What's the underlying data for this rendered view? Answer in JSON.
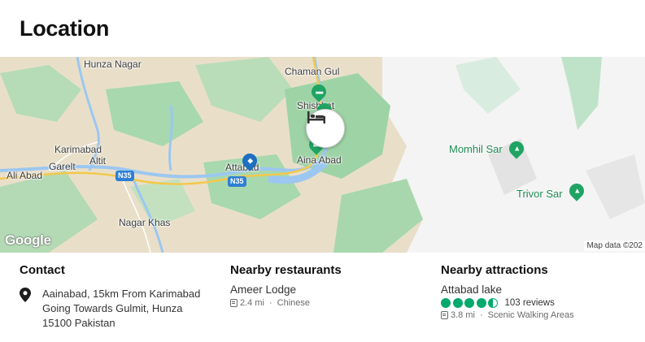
{
  "section": {
    "title": "Location"
  },
  "map": {
    "place_labels": {
      "hunza_nagar": "Hunza Nagar",
      "chaman_gul": "Chaman Gul",
      "shishkat": "Shishkat",
      "karimabad": "Karimabad",
      "garelt": "Garelt",
      "altit": "Altit",
      "ali_abad": "Ali Abad",
      "attabad": "Attabad",
      "aina_abad": "Aina Abad",
      "nagar_khas": "Nagar Khas"
    },
    "attraction_labels": {
      "momhil_sar": "Momhil Sar",
      "trivor_sar": "Trivor Sar"
    },
    "road_shields": [
      "N35",
      "N35"
    ],
    "logo": "Google",
    "attribution": "Map data ©202"
  },
  "contact": {
    "heading": "Contact",
    "address": "Aainabad, 15km From Karimabad Going Towards Gulmit, Hunza 15100 Pakistan"
  },
  "restaurants": {
    "heading": "Nearby restaurants",
    "name": "Ameer Lodge",
    "distance": "2.4 mi",
    "separator": "·",
    "cuisine": "Chinese"
  },
  "attractions": {
    "heading": "Nearby attractions",
    "name": "Attabad lake",
    "rating": 4.5,
    "reviews": "103 reviews",
    "distance": "3.8 mi",
    "separator": "·",
    "category": "Scenic Walking Areas"
  },
  "colors": {
    "rating_green": "#00aa6c",
    "water": "#9cc7f0",
    "forest": "#a8d8ae",
    "terrain": "#e7dcc4",
    "road": "#f2c94c"
  }
}
